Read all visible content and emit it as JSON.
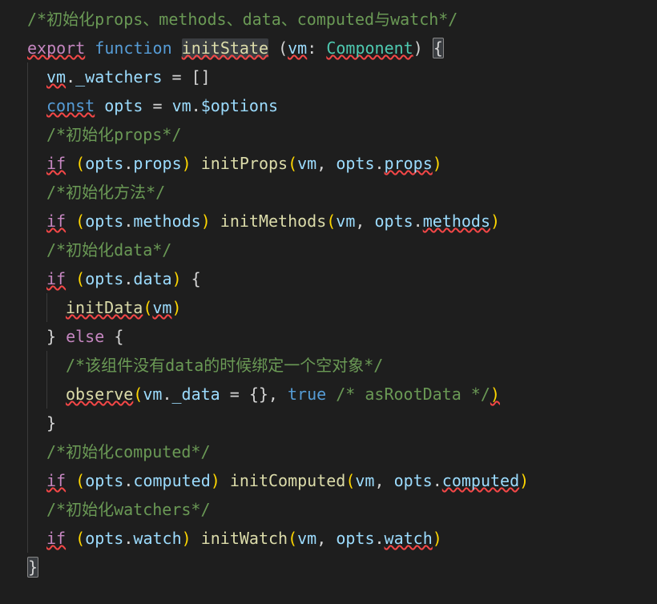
{
  "code": {
    "line1_comment": "/*初始化props、methods、data、computed与watch*/",
    "line2": {
      "export": "export",
      "function": "function",
      "name": "initState",
      "paren_open": " (",
      "param": "vm",
      "colon": ": ",
      "type": "Component",
      "paren_close": ") ",
      "brace": "{"
    },
    "line3": {
      "vm": "vm",
      "dot": ".",
      "watchers": "_watchers",
      "eq": " = ",
      "brackets": "[]"
    },
    "line4": {
      "const": "const",
      "sp": " ",
      "opts": "opts",
      "eq": " = ",
      "vm": "vm",
      "dot": ".",
      "options": "$options"
    },
    "line5_comment": "/*初始化props*/",
    "line6": {
      "if": "if",
      "sp": " ",
      "po": "(",
      "opts": "opts",
      "dot": ".",
      "props": "props",
      "pc": ")",
      "sp2": " ",
      "fn": "initProps",
      "po2": "(",
      "vm": "vm",
      "comma": ", ",
      "opts2": "opts",
      "dot2": ".",
      "props2": "props",
      "pc2": ")"
    },
    "line7_comment": "/*初始化方法*/",
    "line8": {
      "if": "if",
      "sp": " ",
      "po": "(",
      "opts": "opts",
      "dot": ".",
      "methods": "methods",
      "pc": ")",
      "sp2": " ",
      "fn": "initMethods",
      "po2": "(",
      "vm": "vm",
      "comma": ", ",
      "opts2": "opts",
      "dot2": ".",
      "methods2": "methods",
      "pc2": ")"
    },
    "line9_comment": "/*初始化data*/",
    "line10": {
      "if": "if",
      "sp": " ",
      "po": "(",
      "opts": "opts",
      "dot": ".",
      "data": "data",
      "pc": ")",
      "sp2": " ",
      "brace": "{"
    },
    "line11": {
      "fn": "initData",
      "po": "(",
      "vm": "vm",
      "pc": ")"
    },
    "line12": {
      "brace": "}",
      "sp": " ",
      "else": "else",
      "sp2": " ",
      "brace2": "{"
    },
    "line13_comment": "/*该组件没有data的时候绑定一个空对象*/",
    "line14": {
      "fn": "observe",
      "po": "(",
      "vm": "vm",
      "dot": ".",
      "data": "_data",
      "eq": " = ",
      "braces": "{}",
      "comma": ", ",
      "true": "true",
      "sp": " ",
      "comment": "/* asRootData */",
      "pc": ")"
    },
    "line15_brace": "}",
    "line16_comment": "/*初始化computed*/",
    "line17": {
      "if": "if",
      "sp": " ",
      "po": "(",
      "opts": "opts",
      "dot": ".",
      "computed": "computed",
      "pc": ")",
      "sp2": " ",
      "fn": "initComputed",
      "po2": "(",
      "vm": "vm",
      "comma": ", ",
      "opts2": "opts",
      "dot2": ".",
      "computed2": "computed",
      "pc2": ")"
    },
    "line18_comment": "/*初始化watchers*/",
    "line19": {
      "if": "if",
      "sp": " ",
      "po": "(",
      "opts": "opts",
      "dot": ".",
      "watch": "watch",
      "pc": ")",
      "sp2": " ",
      "fn": "initWatch",
      "po2": "(",
      "vm": "vm",
      "comma": ", ",
      "opts2": "opts",
      "dot2": ".",
      "watch2": "watch",
      "pc2": ")"
    },
    "line20_brace": "}"
  }
}
